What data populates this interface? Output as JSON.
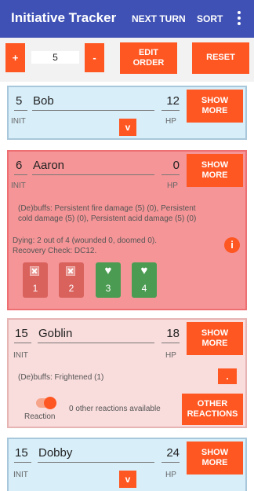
{
  "app": {
    "title": "Initiative Tracker",
    "actions": {
      "next_turn": "NEXT TURN",
      "sort": "SORT"
    },
    "menu_icon": "more-vert-icon"
  },
  "controls": {
    "plus_label": "+",
    "minus_label": "-",
    "counter_value": "5",
    "edit_order_line1": "EDIT",
    "edit_order_line2": "ORDER",
    "reset_label": "RESET"
  },
  "labels": {
    "init": "INIT",
    "hp": "HP",
    "show_more_line1": "SHOW",
    "show_more_line2": "MORE",
    "expand_glyph": "v"
  },
  "combatants": [
    {
      "init": "5",
      "name": "Bob",
      "hp": "12",
      "color": "#d8effa"
    },
    {
      "init": "6",
      "name": "Aaron",
      "hp": "0",
      "color": "#f59597",
      "debuffs_line1": "(De)buffs: Persistent fire damage (5) (0),  Persistent",
      "debuffs_line2": "cold damage (5) (0),  Persistent acid damage (5) (0)",
      "dying_line1": "Dying: 2 out of 4 (wounded 0, doomed 0).",
      "dying_line2": "Recovery Check: DC12.",
      "info_glyph": "i",
      "death_saves": [
        {
          "num": "1",
          "state": "fail",
          "icon": "close-box-icon"
        },
        {
          "num": "2",
          "state": "fail",
          "icon": "close-box-icon"
        },
        {
          "num": "3",
          "state": "success",
          "icon": "heart-icon"
        },
        {
          "num": "4",
          "state": "success",
          "icon": "heart-icon"
        }
      ]
    },
    {
      "init": "15",
      "name": "Goblin",
      "hp": "18",
      "color": "#f9dcdc",
      "debuffs_line1": "(De)buffs: Frightened (1)",
      "small_button_label": ".",
      "reaction_label": "Reaction",
      "reactions_available": "0 other reactions available",
      "other_reactions_line1": "OTHER",
      "other_reactions_line2": "REACTIONS"
    },
    {
      "init": "15",
      "name": "Dobby",
      "hp": "24",
      "color": "#d8effa"
    }
  ],
  "colors": {
    "app_bar": "#3f51b5",
    "accent": "#ff5722",
    "fail": "#d9625d",
    "success": "#4b9c52"
  }
}
